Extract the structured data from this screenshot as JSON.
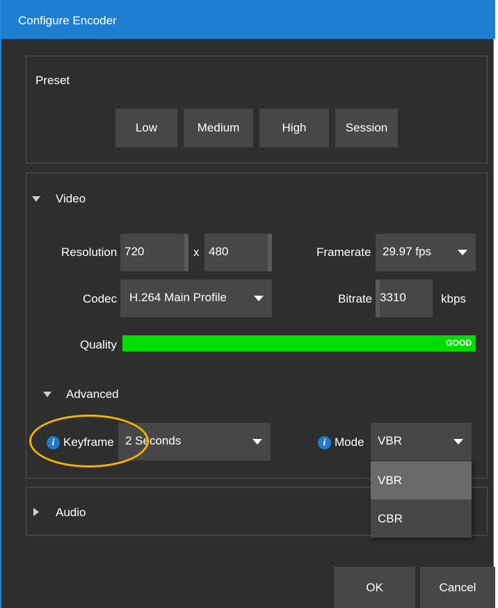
{
  "window": {
    "title": "Configure Encoder"
  },
  "preset": {
    "label": "Preset",
    "buttons": [
      "Low",
      "Medium",
      "High",
      "Session"
    ]
  },
  "video": {
    "section_label": "Video",
    "resolution_label": "Resolution",
    "resolution_width": "720",
    "resolution_separator": "x",
    "resolution_height": "480",
    "framerate_label": "Framerate",
    "framerate_value": "29.97 fps",
    "codec_label": "Codec",
    "codec_value": "H.264 Main Profile",
    "bitrate_label": "Bitrate",
    "bitrate_value": "3310",
    "bitrate_unit": "kbps",
    "quality_label": "Quality",
    "quality_status": "GOOD",
    "quality_level": 1.0,
    "quality_color": "#00dd00"
  },
  "advanced": {
    "section_label": "Advanced",
    "keyframe_label": "Keyframe",
    "keyframe_value": "2 Seconds",
    "mode_label": "Mode",
    "mode_value": "VBR",
    "mode_options": [
      "VBR",
      "CBR"
    ]
  },
  "audio": {
    "section_label": "Audio"
  },
  "footer": {
    "ok_label": "OK",
    "cancel_label": "Cancel"
  },
  "colors": {
    "titlebar": "#1e7fd0",
    "background": "#2e2e2e",
    "control": "#474747",
    "highlight_annotation": "#f5b400",
    "info_icon": "#1f7bd0"
  }
}
